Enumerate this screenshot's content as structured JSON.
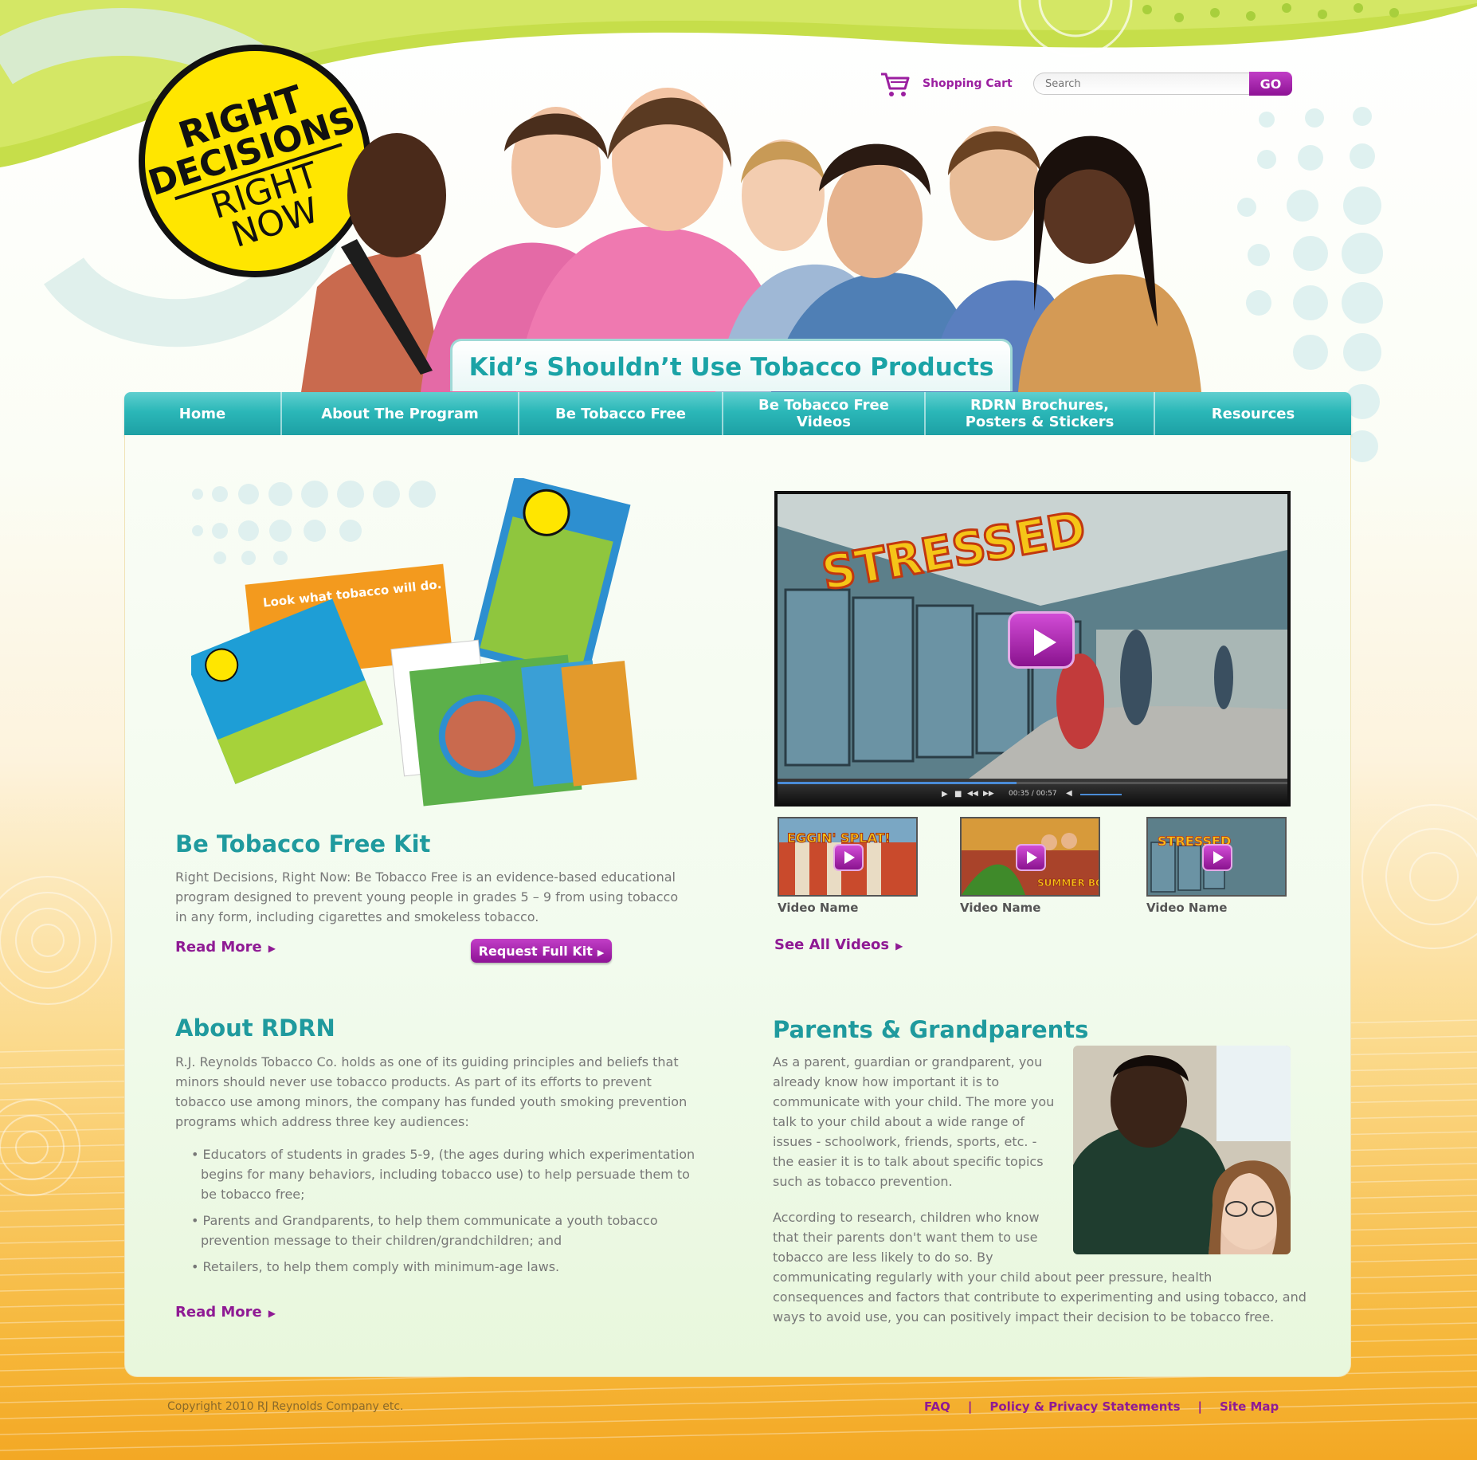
{
  "header": {
    "cart_label": "Shopping Cart",
    "search_placeholder": "Search",
    "search_button": "GO",
    "logo_text": [
      "RIGHT",
      "DECISIONS",
      "RIGHT",
      "NOW"
    ],
    "hero_banner": "Kid’s Shouldn’t Use Tobacco Products"
  },
  "nav": {
    "items": [
      {
        "label": "Home"
      },
      {
        "label": "About The Program"
      },
      {
        "label": "Be Tobacco Free"
      },
      {
        "label": "Be Tobacco Free Videos"
      },
      {
        "label": "RDRN Brochures, Posters & Stickers"
      },
      {
        "label": "Resources"
      }
    ]
  },
  "kit": {
    "title": "Be Tobacco Free Kit",
    "description": "Right Decisions, Right Now: Be Tobacco Free is an evidence-based educational program designed to prevent young people in grades 5 – 9 from using tobacco in any form, including cigarettes and smokeless tobacco.",
    "read_more": "Read More",
    "request_button": "Request Full Kit",
    "image_text": "Look what tobacco will do."
  },
  "video": {
    "featured_title": "STRESSED",
    "time": "00:35 / 00:57",
    "thumbnails": [
      {
        "label": "Video Name",
        "art": "EGGIN' SPLAT!"
      },
      {
        "label": "Video Name",
        "art": "SUMMER BOREDOM"
      },
      {
        "label": "Video Name",
        "art": "STRESSED"
      }
    ],
    "see_all": "See All Videos"
  },
  "about": {
    "title": "About RDRN",
    "intro": "R.J. Reynolds Tobacco Co. holds as one of its guiding principles and beliefs that minors should never use tobacco products. As part of its efforts to prevent tobacco use among minors, the company has funded youth smoking prevention programs which address three key audiences:",
    "bullets": [
      "Educators of students in grades 5-9, (the ages during which experimentation begins for many behaviors, including tobacco use) to help persuade them to be tobacco free;",
      "Parents and Grandparents, to help them communicate a youth tobacco prevention message to their children/grandchildren; and",
      "Retailers, to help them comply with minimum-age laws."
    ],
    "read_more": "Read More"
  },
  "parents": {
    "title": "Parents & Grandparents",
    "p1": "As a parent, guardian or grandparent, you already know how important it is to communicate with your child. The more you talk to your child about a wide range of issues - schoolwork, friends, sports, etc. - the easier it is to talk about specific topics such as tobacco prevention.",
    "p2_start": "According to research, children who know that their parents don't want them to use tobacco are less likely to do so. By",
    "p2_end": "communicating regularly with your child about peer pressure, health consequences and factors that contribute to experimenting and using tobacco, and ways to avoid use, you can positively impact their decision to be tobacco free."
  },
  "footer": {
    "copyright": "Copyright 2010 RJ Reynolds Company etc.",
    "links": [
      "FAQ",
      "Policy & Privacy Statements",
      "Site Map"
    ],
    "separator": "|"
  },
  "colors": {
    "teal": "#1f9a9e",
    "purple": "#8f1a94",
    "lime": "#b7d93a",
    "logo_yellow": "#ffe600",
    "orange": "#f3a824"
  },
  "icons": [
    "shopping-cart-icon",
    "play-icon",
    "chevron-right-icon"
  ]
}
